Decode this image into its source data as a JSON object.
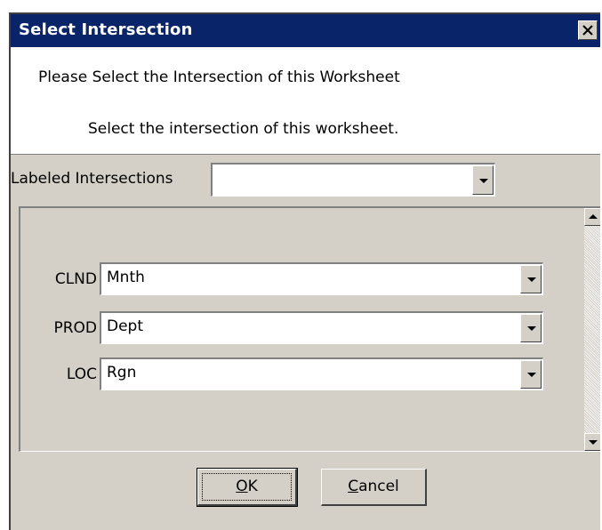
{
  "window": {
    "title": "Select Intersection",
    "title_bar_color": "#0a246a",
    "close_icon": "close-icon"
  },
  "header": {
    "title": "Please Select the Intersection of this Worksheet",
    "description": "Select the intersection of this worksheet."
  },
  "labeled_intersections": {
    "label": "Labeled Intersections",
    "value": ""
  },
  "dimensions": [
    {
      "label": "CLND",
      "value": "Mnth"
    },
    {
      "label": "PROD",
      "value": "Dept"
    },
    {
      "label": "LOC",
      "value": "Rgn"
    }
  ],
  "buttons": {
    "ok": {
      "mnemonic": "O",
      "rest": "K"
    },
    "cancel": {
      "mnemonic": "C",
      "rest": "ancel"
    }
  }
}
